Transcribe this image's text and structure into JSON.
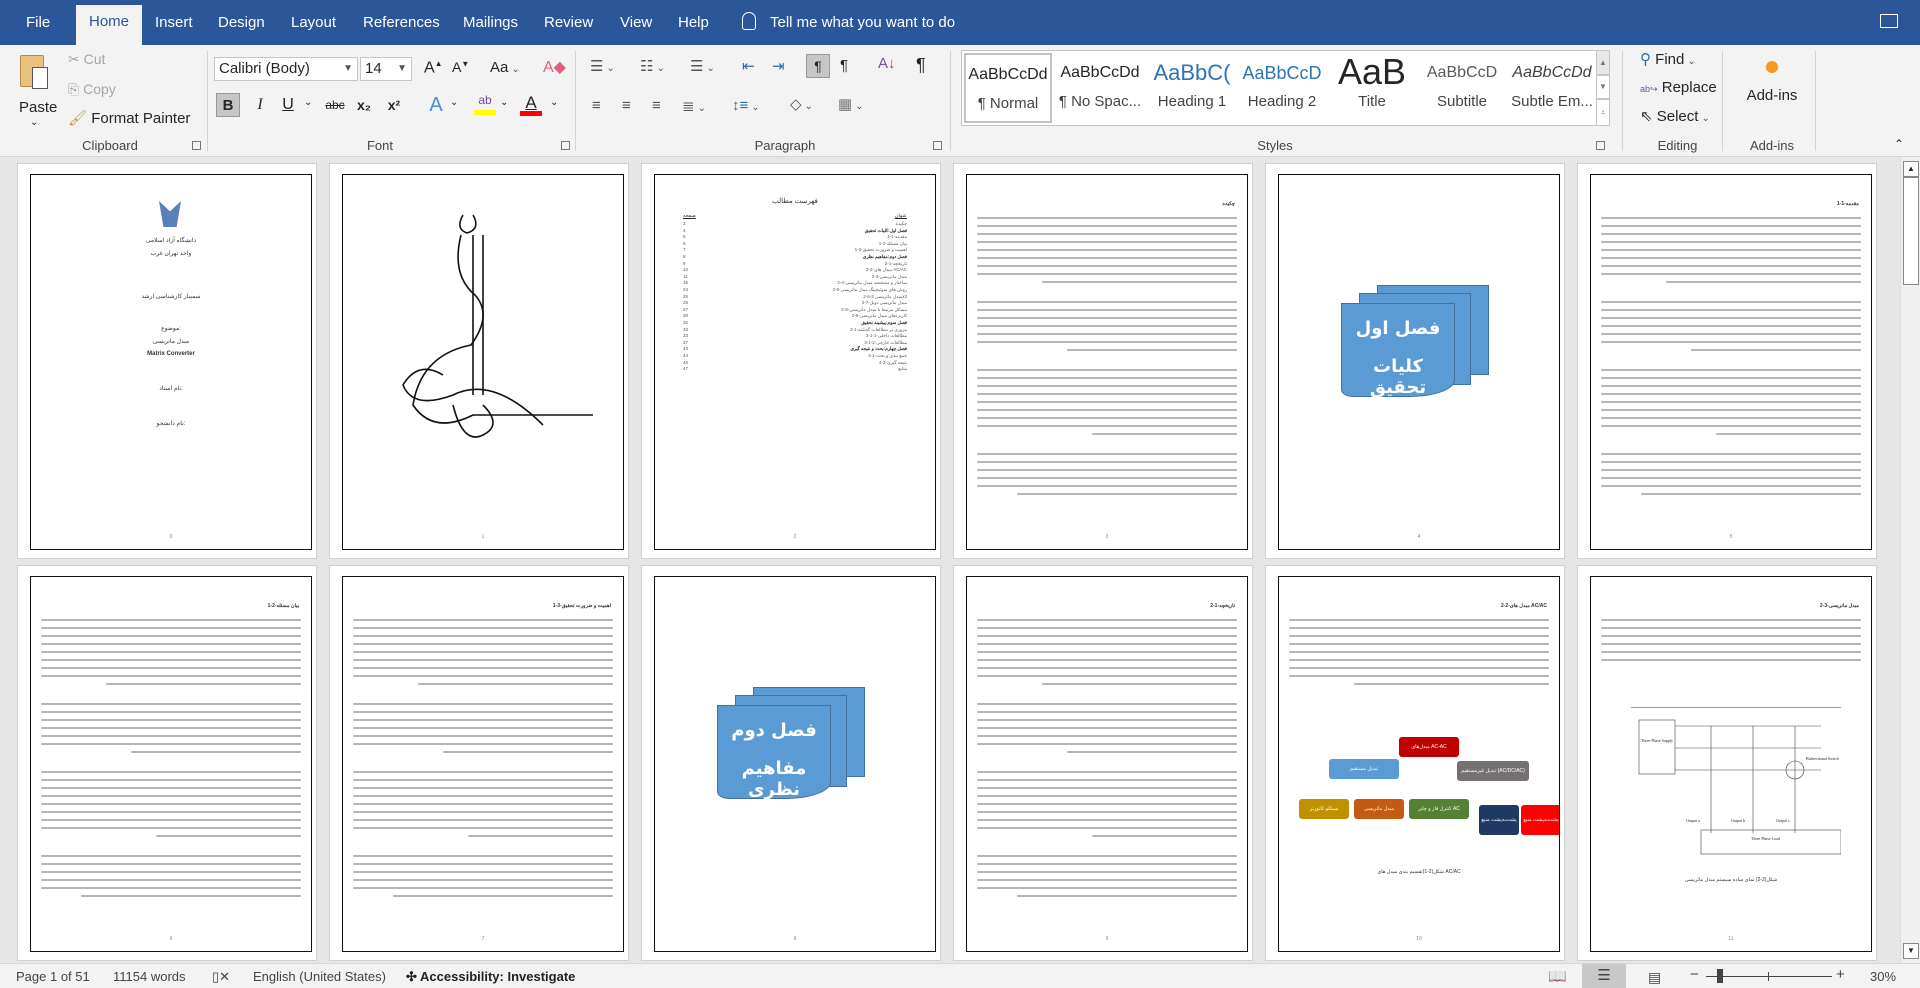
{
  "menu": {
    "tabs": [
      {
        "label": "File"
      },
      {
        "label": "Home"
      },
      {
        "label": "Insert"
      },
      {
        "label": "Design"
      },
      {
        "label": "Layout"
      },
      {
        "label": "References"
      },
      {
        "label": "Mailings"
      },
      {
        "label": "Review"
      },
      {
        "label": "View"
      },
      {
        "label": "Help"
      }
    ],
    "active_tab": "Home",
    "tell_me": "Tell me what you want to do"
  },
  "ribbon": {
    "clipboard": {
      "paste": "Paste",
      "cut": "Cut",
      "copy": "Copy",
      "format_painter": "Format Painter",
      "label": "Clipboard"
    },
    "font": {
      "name": "Calibri (Body)",
      "size": "14",
      "bold": "B",
      "italic": "I",
      "underline": "U",
      "strike": "abc",
      "sub": "x₂",
      "sup": "x²",
      "grow": "A",
      "shrink": "A",
      "case": "Aa",
      "label": "Font",
      "highlight_color": "#ffff00",
      "font_color": "#ff0000"
    },
    "paragraph": {
      "label": "Paragraph"
    },
    "styles": {
      "label": "Styles",
      "items": [
        {
          "preview": "AaBbCcDd",
          "name": "¶ Normal",
          "color": "#000000"
        },
        {
          "preview": "AaBbCcDd",
          "name": "¶ No Spac...",
          "color": "#000000"
        },
        {
          "preview": "AaBbC(",
          "name": "Heading 1",
          "color": "#2e74b5"
        },
        {
          "preview": "AaBbCcD",
          "name": "Heading 2",
          "color": "#2e74b5"
        },
        {
          "preview": "AaB",
          "name": "Title",
          "color": "#000000"
        },
        {
          "preview": "AaBbCcD",
          "name": "Subtitle",
          "color": "#595959"
        },
        {
          "preview": "AaBbCcDd",
          "name": "Subtle Em...",
          "color": "#404040"
        }
      ]
    },
    "editing": {
      "find": "Find",
      "replace": "Replace",
      "select": "Select",
      "label": "Editing"
    },
    "addins": {
      "button": "Add-ins",
      "label": "Add-ins"
    }
  },
  "pages": [
    {
      "num": "0",
      "type": "cover",
      "lines": [
        "دانشگاه آزاد اسلامی",
        "واحد تهران غرب",
        "سمینار کارشناسی ارشد",
        "موضوع:",
        "مبدل ماتریسی",
        "Matrix Converter",
        "نام استاد:",
        "نام دانشجو:"
      ]
    },
    {
      "num": "1",
      "type": "calligraphy"
    },
    {
      "num": "2",
      "type": "toc",
      "title": "فهرست مطالب",
      "col_title": "عنوان",
      "col_page": "صفحه",
      "entries": [
        [
          "چکیده",
          "3"
        ],
        [
          "فصل اول:کلیات تحقیق",
          "4"
        ],
        [
          "1-1-مقدمه",
          "5"
        ],
        [
          "1-2-بیان مسئله",
          "6"
        ],
        [
          "1-3-اهمیت و ضرورت تحقیق",
          "7"
        ],
        [
          "فصل دوم:مفاهیم نظری",
          "8"
        ],
        [
          "2-1-تاریخچه",
          "9"
        ],
        [
          "2-2-مبدل های AC/AC",
          "10"
        ],
        [
          "2-3-مبدل ماتریسی",
          "11"
        ],
        [
          "2-4-ساختار و مشخصه مبدل ماتریسی",
          "16"
        ],
        [
          "2-5-روش های سوئیچینگ مبدل ماتریسی",
          "24"
        ],
        [
          "2-6-مبدل ماتریسی 3x3",
          "25"
        ],
        [
          "2-7-مبدل ماتریسی دوبل",
          "25"
        ],
        [
          "2-8-مسائل مرتبط با مبدل ماتریسی",
          "27"
        ],
        [
          "2-9-کاربردهای مبدل ماتریسی",
          "30"
        ],
        [
          "فصل سوم:پیشینه تحقیق",
          "32"
        ],
        [
          "3-1-مروری بر مطالعات گذشته",
          "33"
        ],
        [
          "3-1-1-مطالعات داخلی",
          "33"
        ],
        [
          "3-1-2-مطالعات خارجی",
          "37"
        ],
        [
          "فصل چهارم:بحث و نتیجه گیری",
          "43"
        ],
        [
          "4-1-جمع بندی و بحث",
          "44"
        ],
        [
          "4-2-نتیجه گیری",
          "46"
        ],
        [
          "منابع",
          "47"
        ]
      ]
    },
    {
      "num": "3",
      "type": "text",
      "heading": "چکیده"
    },
    {
      "num": "4",
      "type": "chapter",
      "line1": "فصل اول",
      "line2": "کلیات تحقیق"
    },
    {
      "num": "5",
      "type": "text",
      "heading": "1-1-مقدمه"
    },
    {
      "num": "6",
      "type": "text",
      "heading": "1-2-بیان مسئله"
    },
    {
      "num": "7",
      "type": "text",
      "heading": "1-3-اهمیت و ضرورت تحقیق"
    },
    {
      "num": "8",
      "type": "chapter",
      "line1": "فصل دوم",
      "line2": "مفاهیم نظری"
    },
    {
      "num": "9",
      "type": "text",
      "heading": "2-1-تاریخچه"
    },
    {
      "num": "10",
      "type": "diagram",
      "heading": "2-2-مبدل های AC/AC",
      "caption": "شکل(2-1)تقسیم بندی مبدل های AC/AC",
      "nodes": {
        "root": "مبدل‌های AC-AC",
        "direct": "تبدیل مستقیم",
        "indirect": "تبدیل غیرمستقیم (AC/DC/AC)",
        "cyclo": "سیکلو کانورتر",
        "matrix": "مبدل ماتریسی",
        "phase": "کنترل فاز و چاپر AC",
        "vsi": "پشت‌به‌پشت منبع ولتاژ",
        "csi": "پشت‌به‌پشت منبع جریان"
      }
    },
    {
      "num": "11",
      "type": "circuit",
      "heading": "2-3-مبدل ماتریسی",
      "caption": "شکل(2-2) نمای ساده سیستم مبدل ماتریسی",
      "labels": {
        "supply": "Three Phase Supply",
        "switch": "Bidirectional Switch",
        "load": "Three Phase Load",
        "a": "Output a",
        "b": "Output b",
        "c": "Output c"
      }
    }
  ],
  "status": {
    "page": "Page 1 of 51",
    "words": "11154 words",
    "language": "English (United States)",
    "accessibility": "Accessibility: Investigate",
    "zoom": "30%",
    "zoom_value": 30
  }
}
